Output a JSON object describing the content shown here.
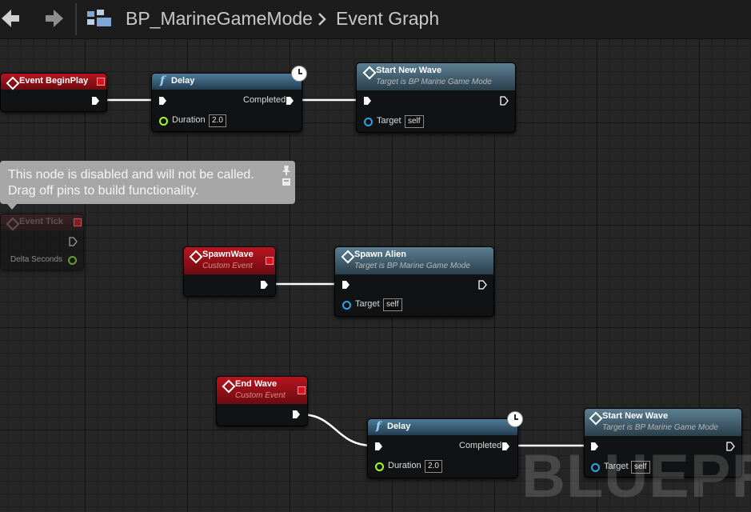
{
  "toolbar": {
    "back_icon": "arrow-left-icon",
    "forward_icon": "arrow-right-icon",
    "blueprint_icon": "blueprint-class-icon",
    "breadcrumb": {
      "blueprint": "BP_MarineGameMode",
      "graph": "Event Graph"
    }
  },
  "colors": {
    "event_header": "#a0131c",
    "function_header": "#3d6680",
    "exec_wire": "#ffffff",
    "float_pin": "#9cff2c",
    "object_pin": "#2ea2e6",
    "comment_bubble": "#a6a6a6"
  },
  "nodes": {
    "event_begin_play": {
      "title": "Event BeginPlay"
    },
    "delay_1": {
      "title": "Delay",
      "completed": "Completed",
      "duration_label": "Duration",
      "duration_value": "2.0"
    },
    "start_new_wave_1": {
      "title": "Start New Wave",
      "subtitle": "Target is BP Marine Game Mode",
      "target_label": "Target",
      "target_value": "self"
    },
    "event_tick": {
      "title": "Event Tick",
      "delta_label": "Delta Seconds",
      "comment_line1": "This node is disabled and will not be called.",
      "comment_line2": "Drag off pins to build functionality."
    },
    "spawn_wave": {
      "title": "SpawnWave",
      "subtitle": "Custom Event"
    },
    "spawn_alien": {
      "title": "Spawn Alien",
      "subtitle": "Target is BP Marine Game Mode",
      "target_label": "Target",
      "target_value": "self"
    },
    "end_wave": {
      "title": "End Wave",
      "subtitle": "Custom Event"
    },
    "delay_2": {
      "title": "Delay",
      "completed": "Completed",
      "duration_label": "Duration",
      "duration_value": "2.0"
    },
    "start_new_wave_2": {
      "title": "Start New Wave",
      "subtitle": "Target is BP Marine Game Mode",
      "target_label": "Target",
      "target_value": "self"
    }
  },
  "watermark": "BLUEPRINT"
}
